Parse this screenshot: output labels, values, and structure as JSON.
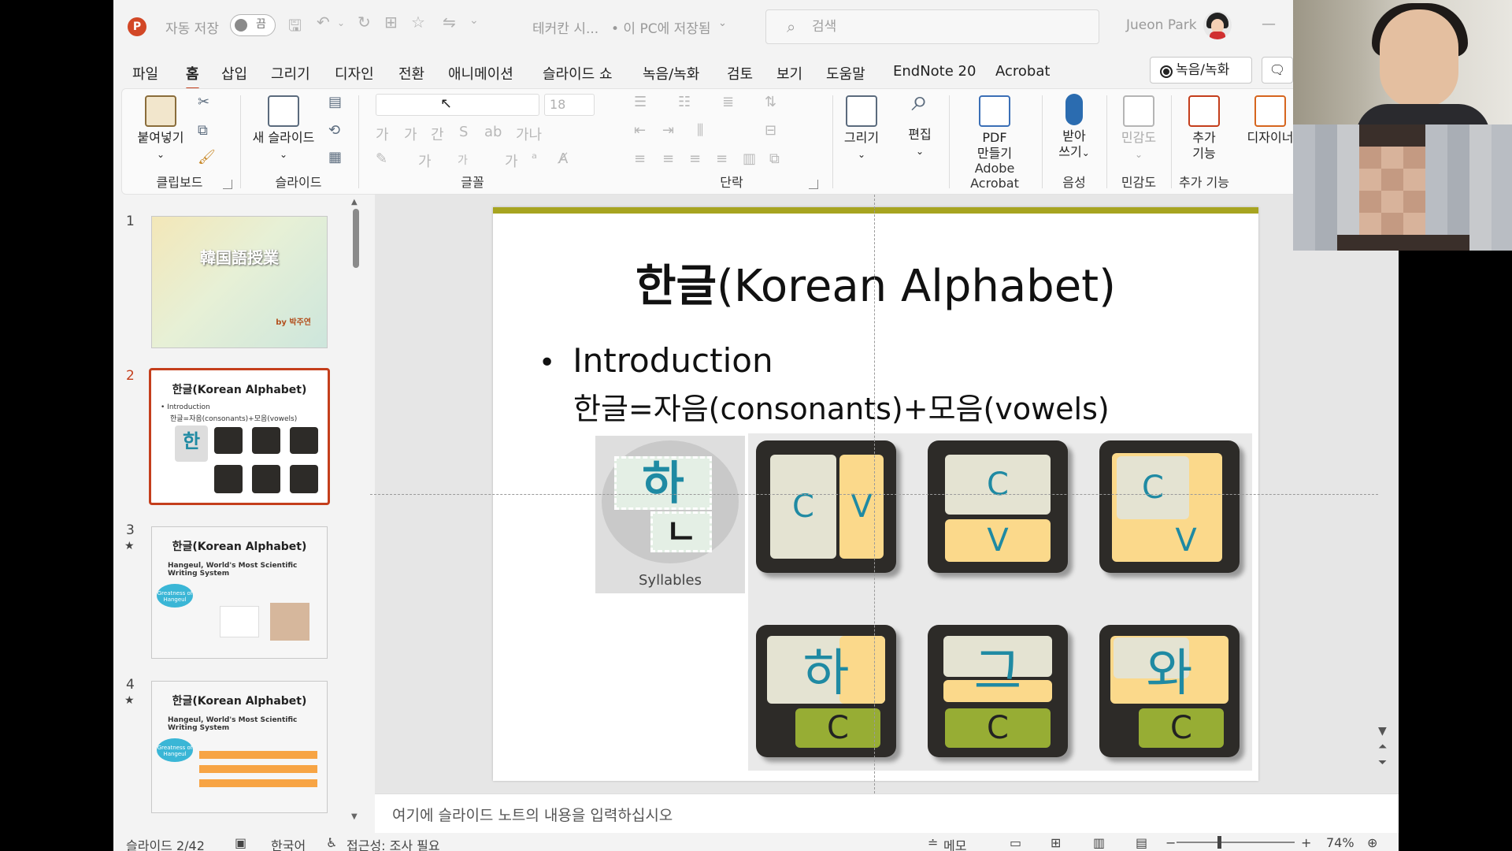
{
  "titlebar": {
    "autosave_label": "자동 저장",
    "autosave_state": "끔",
    "file_name": "테커칸 시...",
    "save_status": "• 이 PC에 저장됨",
    "search_placeholder": "검색",
    "user_name": "Jueon Park"
  },
  "tabs": [
    "파일",
    "홈",
    "삽입",
    "그리기",
    "디자인",
    "전환",
    "애니메이션",
    "슬라이드 쇼",
    "녹음/녹화",
    "검토",
    "보기",
    "도움말",
    "EndNote 20",
    "Acrobat"
  ],
  "active_tab": "홈",
  "record_button": "녹음/녹화",
  "ribbon": {
    "clipboard": {
      "paste": "붙여넣기",
      "label": "클립보드"
    },
    "slides": {
      "new_slide": "새 슬라이드",
      "label": "슬라이드"
    },
    "font": {
      "size": "18",
      "label": "글꼴",
      "icons": [
        "가",
        "가",
        "간",
        "S",
        "ab",
        "가나",
        "가",
        "가",
        "가"
      ]
    },
    "paragraph": {
      "label": "단락"
    },
    "draw": {
      "label": "그리기"
    },
    "edit": {
      "label": "편집"
    },
    "acrobat": {
      "pdf": "PDF",
      "make": "만들기",
      "label": "Adobe Acrobat"
    },
    "voice": {
      "dictate1": "받아",
      "dictate2": "쓰기",
      "label": "음성"
    },
    "sensitivity": {
      "button": "민감도",
      "label": "민감도"
    },
    "addins": {
      "button1": "추가",
      "button2": "기능",
      "label": "추가 기능"
    },
    "designer": {
      "button": "디자이너"
    }
  },
  "thumbnails": [
    {
      "num": "1",
      "title": "韓国語授業",
      "byline": "by 박주연"
    },
    {
      "num": "2",
      "title": "한글(Korean Alphabet)",
      "line1": "Introduction",
      "line2": "한글=자음(consonants)+모음(vowels)"
    },
    {
      "num": "3",
      "title": "한글(Korean Alphabet)",
      "subtitle": "Hangeul, World's Most Scientific Writing System",
      "bubble": "Greatness of Hangeul"
    },
    {
      "num": "4",
      "title": "한글(Korean Alphabet)",
      "subtitle": "Hangeul, World's Most Scientific Writing System",
      "bubble": "Greatness of Hangeul"
    }
  ],
  "slide": {
    "title_korean": "한글",
    "title_english": "(Korean Alphabet)",
    "bullet": "Introduction",
    "formula": "한글=자음(consonants)+모음(vowels)",
    "syllable_caption": "Syllables",
    "syllable_top": "하",
    "syllable_bottom": "ㄴ",
    "tiles": [
      {
        "c": "C",
        "v": "V"
      },
      {
        "c": "C",
        "v": "V"
      },
      {
        "c": "C",
        "v": "V"
      },
      {
        "jamo": "하",
        "final": "C"
      },
      {
        "jamo": "그",
        "final": "C"
      },
      {
        "jamo": "와",
        "final": "C"
      }
    ]
  },
  "notes_placeholder": "여기에 슬라이드 노트의 내용을 입력하십시오",
  "status": {
    "slide_indicator": "슬라이드 2/42",
    "language": "한국어",
    "accessibility": "접근성: 조사 필요",
    "notes": "메모",
    "zoom": "74%"
  },
  "colors": {
    "accent": "#c43e1c",
    "slide_bar": "#a7a420",
    "jamo_blue": "#1f8aa3",
    "green": "#97ad34",
    "yellow": "#fbd98b"
  }
}
